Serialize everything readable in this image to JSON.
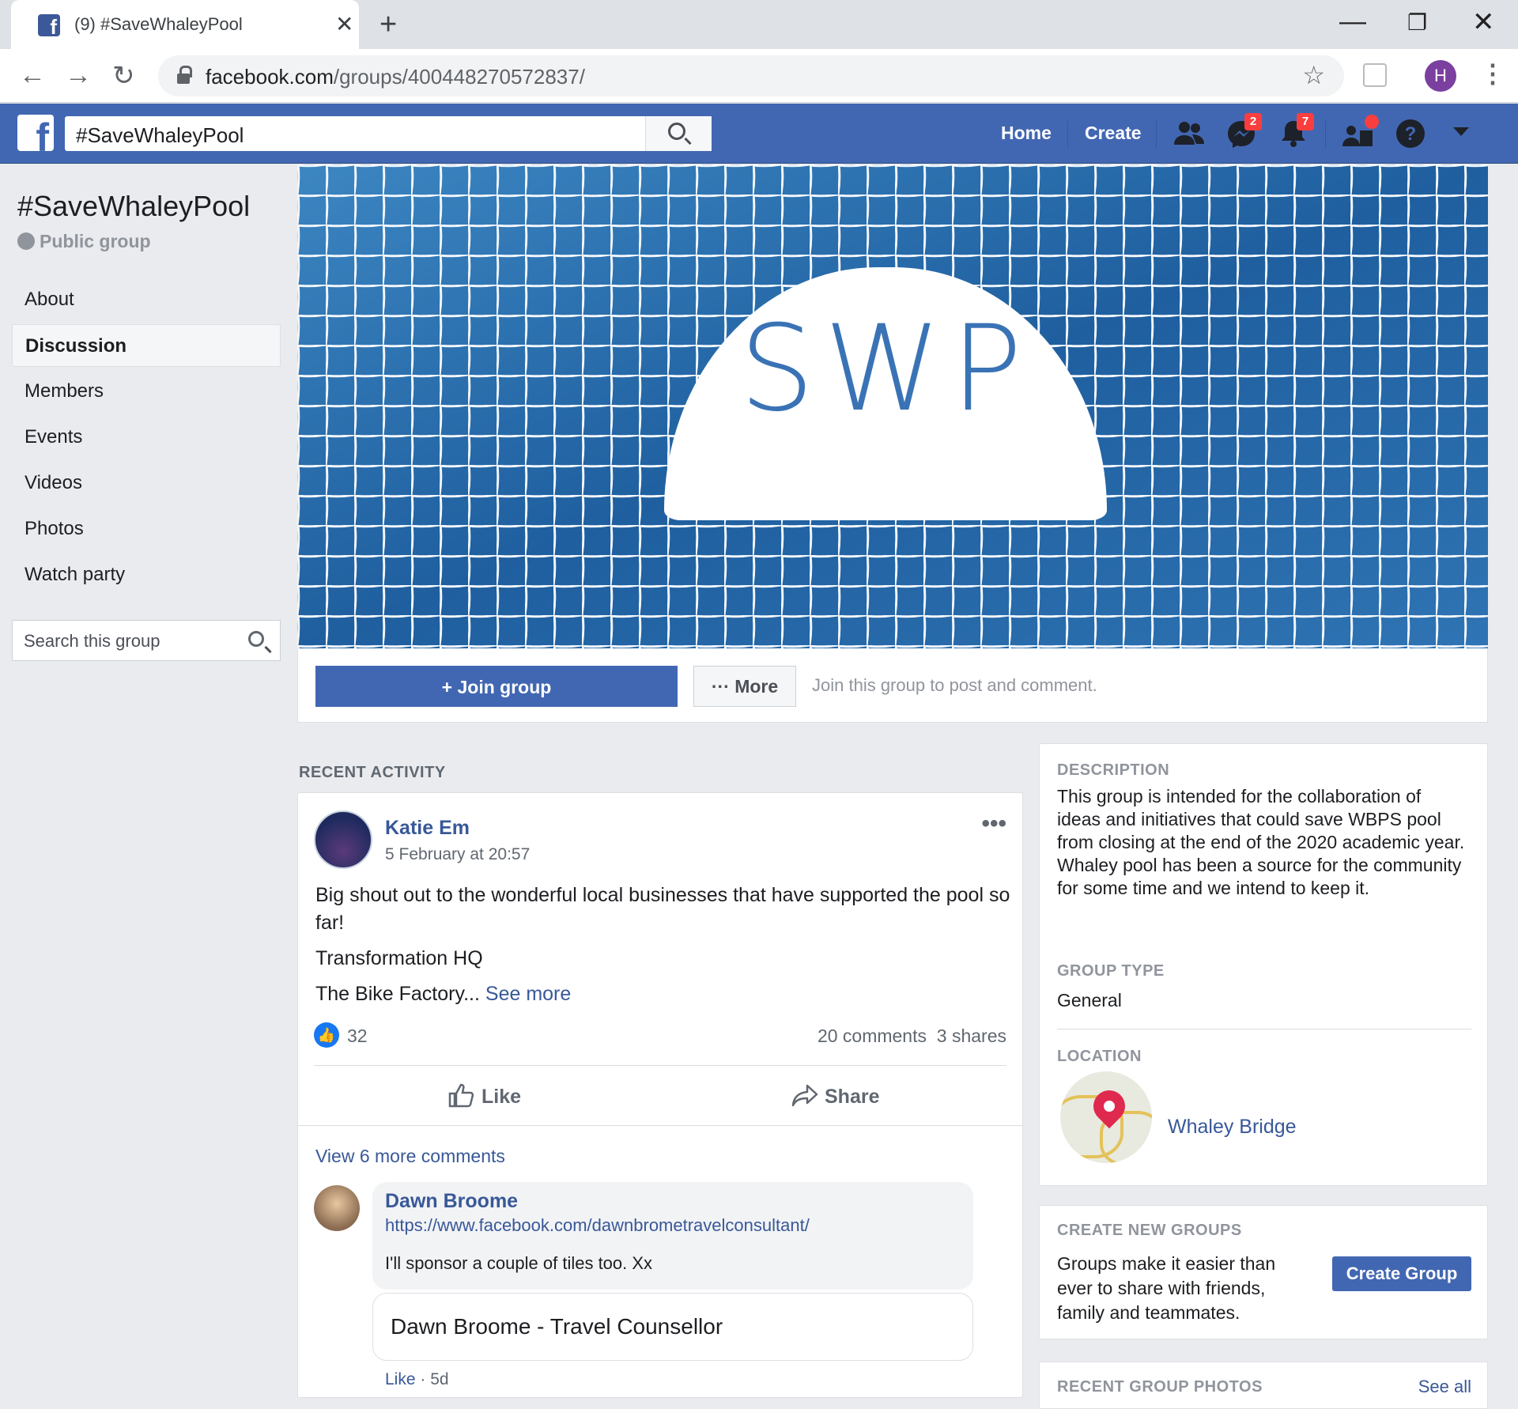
{
  "browser": {
    "tab_title": "(9) #SaveWhaleyPool",
    "url_host": "facebook.com",
    "url_path": "/groups/400448270572837/",
    "avatar_letter": "H"
  },
  "fb_header": {
    "search_value": "#SaveWhaleyPool",
    "nav_home": "Home",
    "nav_create": "Create",
    "messages_badge": "2",
    "notifications_badge": "7"
  },
  "group": {
    "name": "#SaveWhaleyPool",
    "privacy": "Public group",
    "cover_text": "SWP",
    "join_label": "+ Join group",
    "more_label": "··· More",
    "join_hint": "Join this group to post and comment."
  },
  "sidebar": {
    "items": [
      {
        "label": "About"
      },
      {
        "label": "Discussion",
        "active": true
      },
      {
        "label": "Members"
      },
      {
        "label": "Events"
      },
      {
        "label": "Videos"
      },
      {
        "label": "Photos"
      },
      {
        "label": "Watch party"
      }
    ],
    "search_placeholder": "Search this group"
  },
  "feed": {
    "section_title": "RECENT ACTIVITY",
    "post": {
      "author": "Katie Em",
      "time": "5 February at 20:57",
      "body_line1": "Big shout out to the wonderful local businesses that have supported the pool so far!",
      "body_line2": "Transformation HQ",
      "body_line3": "The Bike Factory...",
      "see_more": "See more",
      "reactions": "32",
      "comments": "20 comments",
      "shares": "3 shares",
      "like_label": "Like",
      "share_label": "Share",
      "view_more": "View 6 more comments",
      "comment": {
        "author": "Dawn Broome",
        "link": "https://www.facebook.com/dawnbrometravelconsultant/",
        "text": "I'll sponsor a couple of tiles too. Xx",
        "card_title": "Dawn Broome - Travel Counsellor",
        "like": "Like",
        "age": "· 5d"
      }
    }
  },
  "right": {
    "description_h": "DESCRIPTION",
    "description": "This group is intended for the collaboration of ideas and initiatives that could save WBPS pool from closing at the end of the 2020 academic year.",
    "description2": "Whaley pool has been a source for the community for some time and we intend to keep it.",
    "grouptype_h": "GROUP TYPE",
    "grouptype": "General",
    "location_h": "LOCATION",
    "location": "Whaley Bridge",
    "create_h": "CREATE NEW GROUPS",
    "create_text": "Groups make it easier than ever to share with friends, family and teammates.",
    "create_btn": "Create Group",
    "photos_h": "RECENT GROUP PHOTOS",
    "see_all": "See all"
  },
  "colors": {
    "fb_blue": "#4267b2",
    "link": "#385898",
    "cover_blue": "#2a6aa8"
  }
}
